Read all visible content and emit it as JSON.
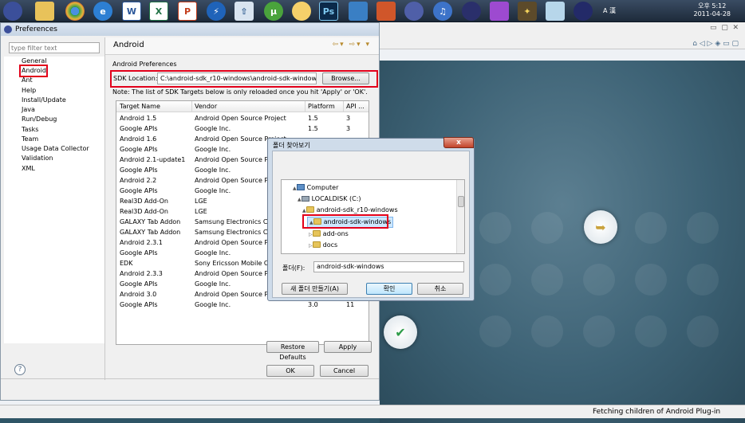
{
  "taskbar": {
    "icons": [
      "eclipse-icon",
      "file-manager-icon",
      "chrome-icon",
      "ie-icon",
      "word-icon",
      "excel-icon",
      "powerpoint-icon",
      "flash-icon",
      "upload-icon",
      "utorrent-icon",
      "messenger-icon",
      "photoshop-icon",
      "monitor-icon",
      "matlab-icon",
      "disc-icon",
      "itunes-icon",
      "eclipse-planet-icon",
      "app-icon",
      "magic-wand-icon",
      "notepad-icon",
      "eclipse-dark-icon"
    ],
    "ps_label": "Ps",
    "tray_lang": "A 漢",
    "clock_time": "오후 5:12",
    "clock_date": "2011-04-28"
  },
  "prefs": {
    "title": "Preferences",
    "filter_placeholder": "type filter text",
    "tree": [
      "General",
      "Android",
      "Ant",
      "Help",
      "Install/Update",
      "Java",
      "Run/Debug",
      "Tasks",
      "Team",
      "Usage Data Collector",
      "Validation",
      "XML"
    ],
    "page_title": "Android",
    "android_preferences": "Android Preferences",
    "sdk_location_label": "SDK Location:",
    "sdk_location_value": "C:\\android-sdk_r10-windows\\android-sdk-windows",
    "browse_label": "Browse...",
    "note": "Note: The list of SDK Targets below is only reloaded once you hit 'Apply' or 'OK'.",
    "columns": [
      "Target Name",
      "Vendor",
      "Platform",
      "API ..."
    ],
    "rows": [
      [
        "Android 1.5",
        "Android Open Source Project",
        "1.5",
        "3"
      ],
      [
        "Google APIs",
        "Google Inc.",
        "1.5",
        "3"
      ],
      [
        "Android 1.6",
        "Android Open Source Project",
        "",
        ""
      ],
      [
        "Google APIs",
        "Google Inc.",
        "",
        ""
      ],
      [
        "Android 2.1-update1",
        "Android Open Source Project",
        "",
        ""
      ],
      [
        "Google APIs",
        "Google Inc.",
        "",
        ""
      ],
      [
        "Android 2.2",
        "Android Open Source Project",
        "",
        ""
      ],
      [
        "Google APIs",
        "Google Inc.",
        "",
        ""
      ],
      [
        "Real3D Add-On",
        "LGE",
        "",
        ""
      ],
      [
        "Real3D Add-On",
        "LGE",
        "",
        ""
      ],
      [
        "GALAXY Tab Addon",
        "Samsung Electronics Co.",
        "",
        ""
      ],
      [
        "GALAXY Tab Addon",
        "Samsung Electronics Co.",
        "",
        ""
      ],
      [
        "Android 2.3.1",
        "Android Open Source Project",
        "",
        ""
      ],
      [
        "Google APIs",
        "Google Inc.",
        "",
        ""
      ],
      [
        "EDK",
        "Sony Ericsson Mobile Co.",
        "",
        ""
      ],
      [
        "Android 2.3.3",
        "Android Open Source Project",
        "",
        ""
      ],
      [
        "Google APIs",
        "Google Inc.",
        "",
        ""
      ],
      [
        "Android 3.0",
        "Android Open Source Project",
        "",
        ""
      ],
      [
        "Google APIs",
        "Google Inc.",
        "3.0",
        "11"
      ]
    ],
    "restore_defaults": "Restore Defaults",
    "apply": "Apply",
    "ok": "OK",
    "cancel": "Cancel",
    "help_symbol": "?"
  },
  "browse_dialog": {
    "title": "폴더 찾아보기",
    "close": "x",
    "tree": [
      {
        "label": "Computer",
        "icon": "computer-icon",
        "expander": "▲"
      },
      {
        "label": "LOCALDISK (C:)",
        "icon": "drive-icon",
        "expander": "▲"
      },
      {
        "label": "android-sdk_r10-windows",
        "icon": "folder-icon",
        "expander": "▲"
      },
      {
        "label": "android-sdk-windows",
        "icon": "folder-icon",
        "expander": "▲"
      },
      {
        "label": "add-ons",
        "icon": "folder-icon",
        "expander": "▷"
      },
      {
        "label": "docs",
        "icon": "folder-icon",
        "expander": "▷"
      }
    ],
    "folder_label": "폴더(F):",
    "folder_value": "android-sdk-windows",
    "new_folder": "새 폴더 만들기(A)",
    "ok": "확인",
    "cancel": "취소"
  },
  "status": {
    "text": "Fetching children of Android Plug-in"
  },
  "colors": {
    "highlight_box": "#e2001a",
    "selection": "#cde8ff",
    "welcome_bg": "#3d6275"
  }
}
